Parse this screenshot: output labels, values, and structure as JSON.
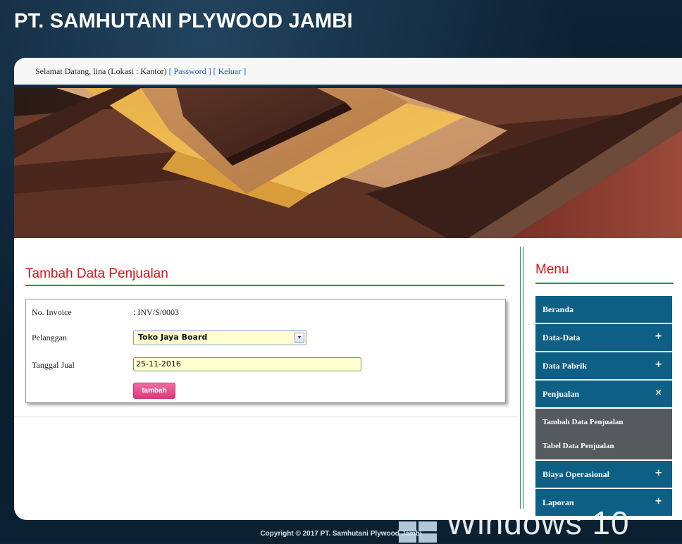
{
  "header": {
    "site_title": "PT. SAMHUTANI PLYWOOD JAMBI"
  },
  "welcome": {
    "greeting": "Selamat Datang, lina (Lokasi : Kantor)",
    "password_link": "[ Password ]",
    "logout_link": "[ Keluar ]"
  },
  "main": {
    "title": "Tambah Data Penjualan",
    "form": {
      "invoice_label": "No. Invoice",
      "invoice_value": ": INV/S/0003",
      "customer_label": "Pelanggan",
      "customer_selected": "Toko Jaya Board",
      "date_label": "Tanggal Jual",
      "date_value": "25-11-2016",
      "submit_label": "tambah"
    }
  },
  "sidebar": {
    "title": "Menu",
    "items": [
      {
        "label": "Beranda",
        "sign": ""
      },
      {
        "label": "Data-Data",
        "sign": "+"
      },
      {
        "label": "Data Pabrik",
        "sign": "+"
      },
      {
        "label": "Penjualan",
        "sign": "×"
      },
      {
        "label": "Biaya Operasional",
        "sign": "+"
      },
      {
        "label": "Laporan",
        "sign": "+"
      }
    ],
    "penjualan_sub": [
      {
        "label": "Tambah Data Penjualan"
      },
      {
        "label": "Tabel Data Penjualan"
      }
    ]
  },
  "footer": {
    "copyright": "Copyright © 2017 PT. Samhutani Plywood Jambi",
    "watermark_text": "Windows 10"
  },
  "colors": {
    "accent_title": "#d4141a",
    "accent_line": "#1b9a48",
    "menu_bg": "#0e5f86",
    "submenu_bg": "#555a5e",
    "button_pink": "#e0397a"
  }
}
